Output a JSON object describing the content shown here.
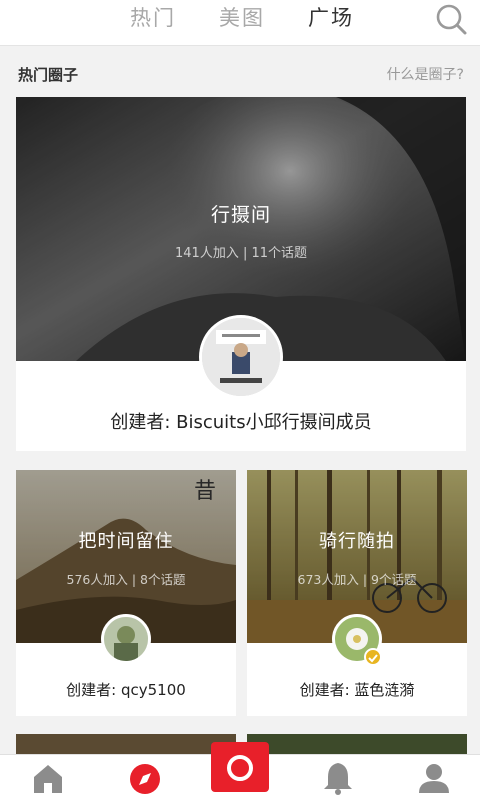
{
  "tabs": {
    "hot": "热门",
    "pics": "美图",
    "square": "广场",
    "active": "square"
  },
  "section": {
    "title": "热门圈子",
    "link": "什么是圈子?"
  },
  "circles": [
    {
      "name": "行摄间",
      "meta": "141人加入 | 11个话题",
      "creator": "创建者: Biscuits小邱行摄间成员"
    },
    {
      "name": "把时间留住",
      "meta": "576人加入 | 8个话题",
      "creator": "创建者: qcy5100"
    },
    {
      "name": "骑行随拍",
      "meta": "673人加入 | 9个话题",
      "creator": "创建者: 蓝色涟漪"
    }
  ],
  "icons": {
    "search": "search-icon",
    "home": "home-icon",
    "discover": "compass-icon",
    "camera": "camera-icon",
    "notifications": "bell-icon",
    "profile": "user-icon"
  },
  "colors": {
    "accent": "#e8202a",
    "active_tab": "#333333",
    "inactive_tab": "#a8a8a8",
    "verified": "#e8b521"
  }
}
